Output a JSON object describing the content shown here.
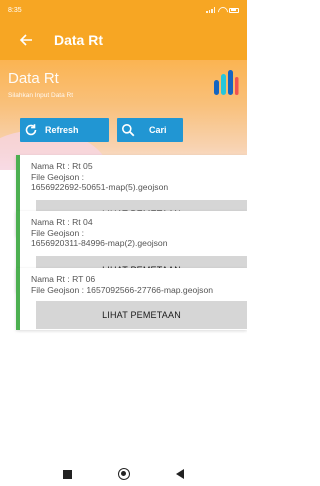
{
  "status_bar": {
    "time": "8:35"
  },
  "app_bar": {
    "title": "Data Rt",
    "back_icon": "arrow-left-icon"
  },
  "banner": {
    "title": "Data Rt",
    "subtitle": "Silahkan Input Data Rt",
    "refresh_label": "Refresh",
    "search_label": "Cari",
    "accent": "#2196d3"
  },
  "cards": [
    {
      "line1": "Nama Rt : Rt 05",
      "line2": "File Geojson :",
      "line3": "1656922692-50651-map(5).geojson",
      "button_label": "LIHAT PEMETAAN"
    },
    {
      "line1": "Nama Rt : Rt 04",
      "line2": "File Geojson :",
      "line3": "1656920311-84996-map(2).geojson",
      "button_label": "LIHAT PEMETAAN"
    },
    {
      "line1": "Nama Rt : RT 06",
      "line2": "File Geojson : 1657092566-27766-map.geojson",
      "button_label": "LIHAT PEMETAAN"
    }
  ],
  "colors": {
    "primary": "#f7a623",
    "card_accent": "#4caf50",
    "button": "#2196d3"
  }
}
